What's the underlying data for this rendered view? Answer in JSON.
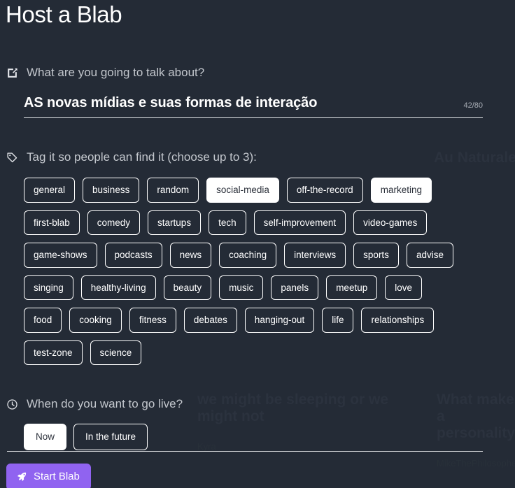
{
  "page": {
    "title": "Host a Blab",
    "background_color": "#242b36",
    "accent_color": "#9063f0"
  },
  "topic": {
    "icon": "edit-square-icon",
    "heading": "What are you going to talk about?",
    "value": "AS novas mídias e suas formas de interação",
    "placeholder": "What are you going to talk about?",
    "char_count": "42/80"
  },
  "tags": {
    "icon": "tag-icon",
    "heading": "Tag it so people can find it (choose up to 3):",
    "items": [
      {
        "label": "general",
        "selected": false
      },
      {
        "label": "business",
        "selected": false
      },
      {
        "label": "random",
        "selected": false
      },
      {
        "label": "social-media",
        "selected": true
      },
      {
        "label": "off-the-record",
        "selected": false
      },
      {
        "label": "marketing",
        "selected": true
      },
      {
        "label": "first-blab",
        "selected": false
      },
      {
        "label": "comedy",
        "selected": false
      },
      {
        "label": "startups",
        "selected": false
      },
      {
        "label": "tech",
        "selected": false
      },
      {
        "label": "self-improvement",
        "selected": false
      },
      {
        "label": "video-games",
        "selected": false
      },
      {
        "label": "game-shows",
        "selected": false
      },
      {
        "label": "podcasts",
        "selected": false
      },
      {
        "label": "news",
        "selected": false
      },
      {
        "label": "coaching",
        "selected": false
      },
      {
        "label": "interviews",
        "selected": false
      },
      {
        "label": "sports",
        "selected": false
      },
      {
        "label": "advise",
        "selected": false
      },
      {
        "label": "singing",
        "selected": false
      },
      {
        "label": "healthy-living",
        "selected": false
      },
      {
        "label": "beauty",
        "selected": false
      },
      {
        "label": "music",
        "selected": false
      },
      {
        "label": "panels",
        "selected": false
      },
      {
        "label": "meetup",
        "selected": false
      },
      {
        "label": "love",
        "selected": false
      },
      {
        "label": "food",
        "selected": false
      },
      {
        "label": "cooking",
        "selected": false
      },
      {
        "label": "fitness",
        "selected": false
      },
      {
        "label": "debates",
        "selected": false
      },
      {
        "label": "hanging-out",
        "selected": false
      },
      {
        "label": "life",
        "selected": false
      },
      {
        "label": "relationships",
        "selected": false
      },
      {
        "label": "test-zone",
        "selected": false
      },
      {
        "label": "science",
        "selected": false
      }
    ]
  },
  "schedule": {
    "icon": "clock-icon",
    "heading": "When do you want to go live?",
    "options": [
      {
        "label": "Now",
        "selected": true
      },
      {
        "label": "In the future",
        "selected": false
      }
    ]
  },
  "footer": {
    "start_button_label": "Start Blab",
    "start_button_icon": "rocket-icon"
  },
  "background_cards": [
    {
      "title": "we might be sleeping or we might not",
      "sub": "Kyra",
      "meta": ""
    },
    {
      "title": "What makes a personality?",
      "sub": "MikeThePhilosopher",
      "meta": ""
    },
    {
      "title": "Au Naturale",
      "sub": "",
      "meta": ""
    }
  ]
}
